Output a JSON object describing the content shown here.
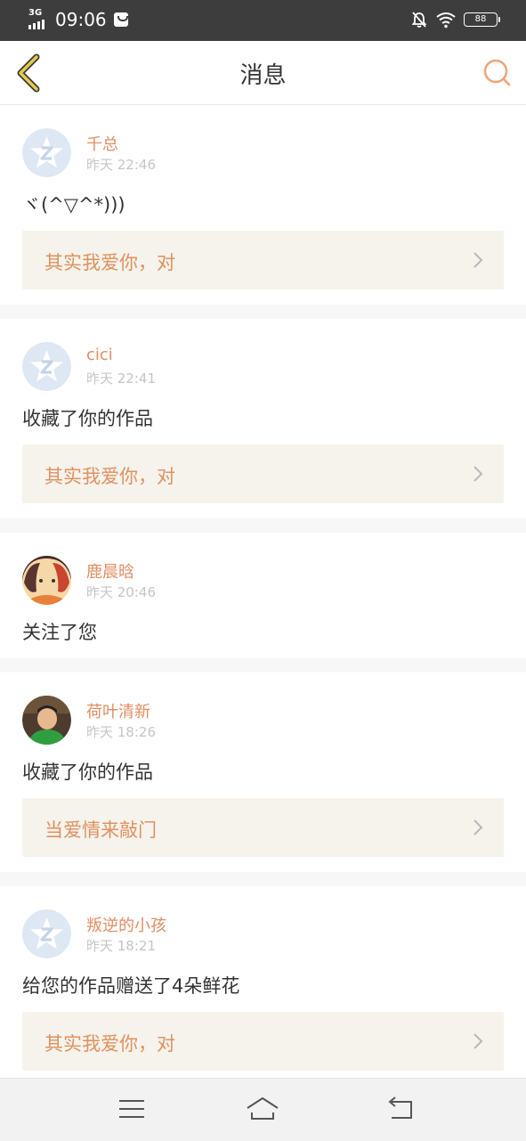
{
  "status_bar": {
    "network": "3G",
    "time": "09:06",
    "battery": "88",
    "icons": [
      "signal-icon",
      "bag-icon",
      "mute-icon",
      "wifi-icon",
      "battery-icon"
    ]
  },
  "header": {
    "title": "消息",
    "back_icon": "chevron-left-icon",
    "search_icon": "search-icon"
  },
  "colors": {
    "accent": "#e08e63",
    "time_gray": "#c6c6c6",
    "quote_bg": "#f5f3ec",
    "status_bar_bg": "#3d3d3d"
  },
  "messages": [
    {
      "name": "千总",
      "time": "昨天 22:46",
      "text": "ヾ(^▽^*)))",
      "quote": "其实我爱你，对",
      "avatar": "default-avatar"
    },
    {
      "name": "cici",
      "time": "昨天 22:41",
      "text": "收藏了你的作品",
      "quote": "其实我爱你，对",
      "avatar": "default-avatar"
    },
    {
      "name": "鹿晨晗",
      "time": "昨天 20:46",
      "text": "关注了您",
      "quote": "",
      "avatar": "anime-avatar"
    },
    {
      "name": "荷叶清新",
      "time": "昨天 18:26",
      "text": "收藏了你的作品",
      "quote": "当爱情来敲门",
      "avatar": "photo-avatar"
    },
    {
      "name": "叛逆的小孩",
      "time": "昨天 18:21",
      "text": "给您的作品赠送了4朵鲜花",
      "quote": "其实我爱你，对",
      "avatar": "default-avatar"
    }
  ],
  "nav_bar": {
    "icons": [
      "menu-icon",
      "home-icon",
      "back-icon"
    ]
  }
}
